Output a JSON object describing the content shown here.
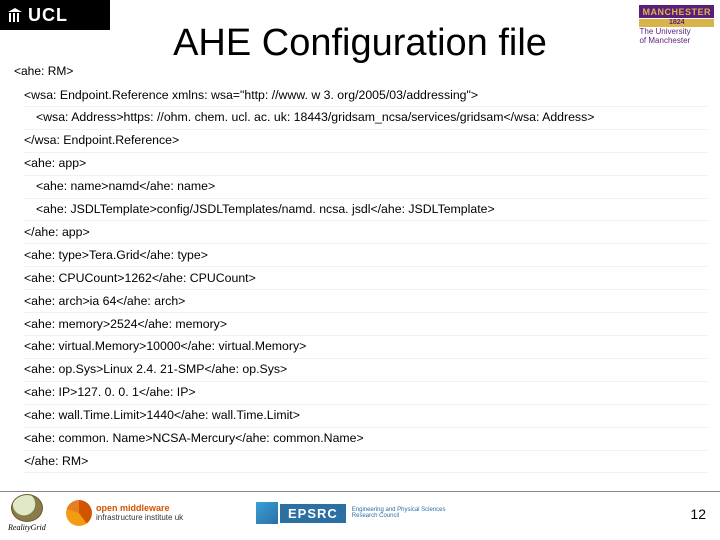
{
  "header": {
    "ucl_text": "UCL",
    "manchester_badge": "MANCHESTER",
    "manchester_year": "1824",
    "manchester_sub1": "The University",
    "manchester_sub2": "of Manchester",
    "title": "AHE Configuration file"
  },
  "root_tag": "<ahe: RM>",
  "lines": [
    {
      "indent": false,
      "text": "<wsa: Endpoint.Reference xmlns: wsa=\"http: //www. w 3. org/2005/03/addressing\">"
    },
    {
      "indent": true,
      "text": "<wsa: Address>https: //ohm. chem. ucl. ac. uk: 18443/gridsam_ncsa/services/gridsam</wsa: Address>"
    },
    {
      "indent": false,
      "text": "</wsa: Endpoint.Reference>"
    },
    {
      "indent": false,
      "text": "<ahe: app>"
    },
    {
      "indent": true,
      "text": "<ahe: name>namd</ahe: name>"
    },
    {
      "indent": true,
      "text": "<ahe: JSDLTemplate>config/JSDLTemplates/namd. ncsa. jsdl</ahe: JSDLTemplate>"
    },
    {
      "indent": false,
      "text": "</ahe: app>"
    },
    {
      "indent": false,
      "text": "<ahe: type>Tera.Grid</ahe: type>"
    },
    {
      "indent": false,
      "text": "<ahe: CPUCount>1262</ahe: CPUCount>"
    },
    {
      "indent": false,
      "text": "<ahe: arch>ia 64</ahe: arch>"
    },
    {
      "indent": false,
      "text": "<ahe: memory>2524</ahe: memory>"
    },
    {
      "indent": false,
      "text": "<ahe: virtual.Memory>10000</ahe: virtual.Memory>"
    },
    {
      "indent": false,
      "text": "<ahe: op.Sys>Linux 2.4. 21-SMP</ahe: op.Sys>"
    },
    {
      "indent": false,
      "text": "<ahe: IP>127. 0. 0. 1</ahe: IP>"
    },
    {
      "indent": false,
      "text": "<ahe: wall.Time.Limit>1440</ahe: wall.Time.Limit>"
    },
    {
      "indent": false,
      "text": "<ahe: common. Name>NCSA-Mercury</ahe: common.Name>"
    },
    {
      "indent": false,
      "text": "</ahe: RM>"
    }
  ],
  "footer": {
    "realitygrid": "RealityGrid",
    "omii_bold": "open middleware",
    "omii_rest": "infrastructure institute uk",
    "epsrc": "EPSRC",
    "epsrc_sub1": "Engineering and Physical Sciences",
    "epsrc_sub2": "Research Council",
    "page": "12"
  }
}
